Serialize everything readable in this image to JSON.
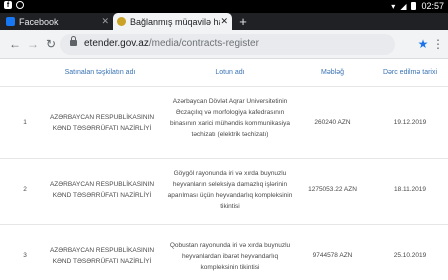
{
  "status_bar": {
    "time": "02:57"
  },
  "tabs": [
    {
      "title": "Facebook",
      "close": "✕"
    },
    {
      "title": "Bağlanmış müqavilə haqqında",
      "close": "✕"
    }
  ],
  "new_tab_label": "+",
  "address_bar": {
    "domain": "etender.gov.az",
    "path": "/media/contracts-register"
  },
  "table": {
    "headers": [
      "Satınalan təşkilatın adı",
      "Lotun adı",
      "Məbləğ",
      "Dərc edilmə tarixi"
    ],
    "rows": [
      {
        "number": "1",
        "organization": "AZƏRBAYCAN RESPUBLİKASININ KƏND TƏSƏRRÜFATI NAZİRLİYİ",
        "lot": "Azərbaycan Dövlət Aqrar Universitetinin Əczaçılıq və morfologiya kafedrasının binasının xarici mühəndis kommunikasiya təchizatı (elektrik təchizatı)",
        "amount": "260240 AZN",
        "date": "19.12.2019"
      },
      {
        "number": "2",
        "organization": "AZƏRBAYCAN RESPUBLİKASININ KƏND TƏSƏRRÜFATI NAZİRLİYİ",
        "lot": "Göygöl rayonunda iri və xırda buynuzlu heyvanların seleksiya damazlıq işlərinin aparılması üçün heyvandarlıq kompleksinin tikintisi",
        "amount": "1275053.22 AZN",
        "date": "18.11.2019"
      },
      {
        "number": "3",
        "organization": "AZƏRBAYCAN RESPUBLİKASININ KƏND TƏSƏRRÜFATI NAZİRLİYİ",
        "lot": "Qobustan rayonunda iri və xırda buynuzlu heyvanlardan ibarət heyvandarlıq kompleksinin tikintisi",
        "amount": "9744578 AZN",
        "date": "25.10.2019"
      }
    ]
  }
}
